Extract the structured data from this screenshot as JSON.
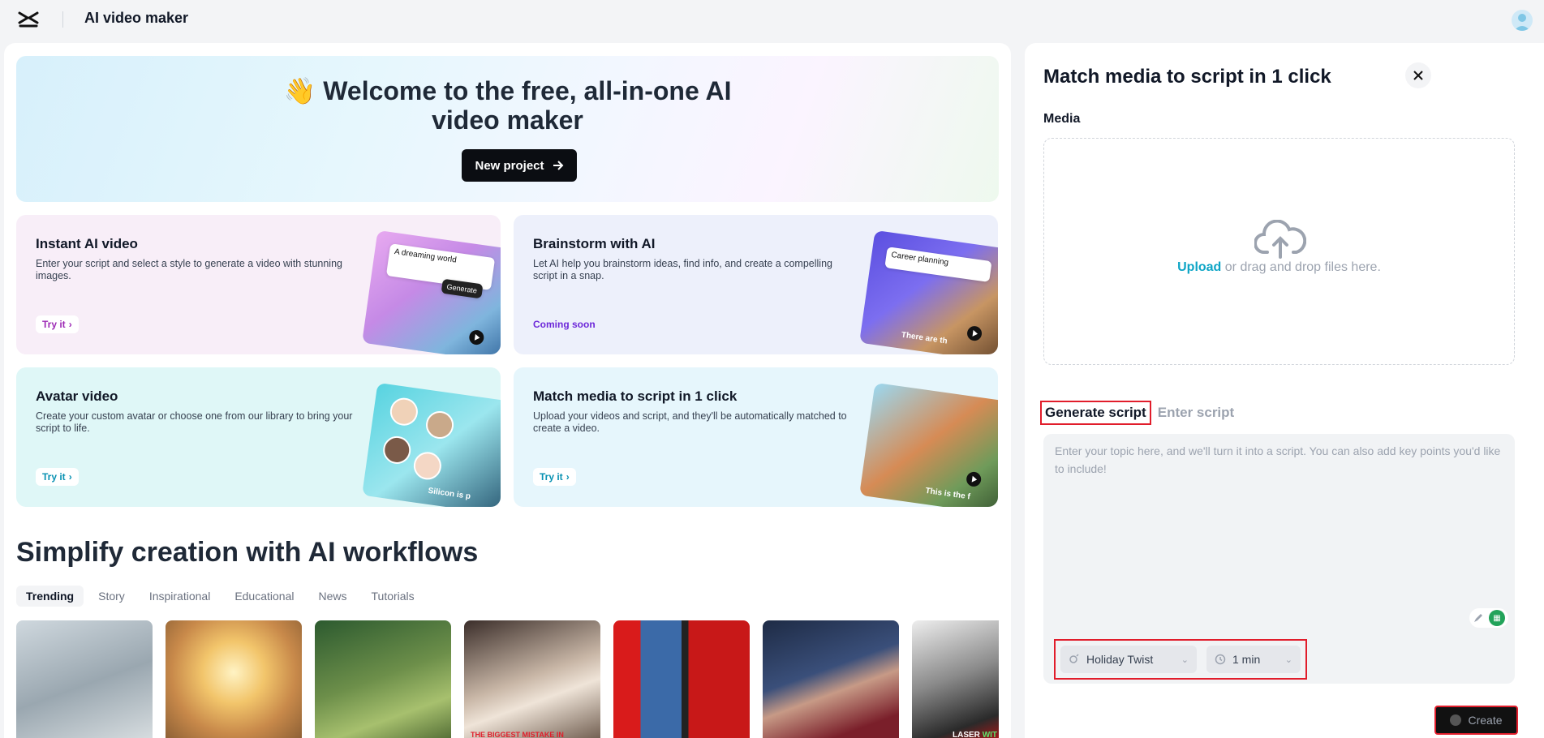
{
  "header": {
    "app_title": "AI video maker"
  },
  "hero": {
    "emoji": "👋",
    "title_line1": "Welcome to the free, all-in-one AI",
    "title_line2": "video maker",
    "new_project_label": "New project"
  },
  "cards": [
    {
      "title": "Instant AI video",
      "desc": "Enter your script and select a style to generate a video with stunning images.",
      "action": "Try it",
      "art_chip": "A dreaming world",
      "art_btn": "Generate"
    },
    {
      "title": "Brainstorm with AI",
      "desc": "Let AI help you brainstorm ideas, find info, and create a compelling script in a snap.",
      "action": "Coming soon",
      "art_chip": "Career planning",
      "art_caption": "There are th"
    },
    {
      "title": "Avatar video",
      "desc": "Create your custom avatar or choose one from our library to bring your script to life.",
      "action": "Try it",
      "art_caption": "Silicon is p"
    },
    {
      "title": "Match media to script in 1 click",
      "desc": "Upload your videos and script, and they'll be automatically matched to create a video.",
      "action": "Try it",
      "art_caption": "This is the f"
    }
  ],
  "workflows": {
    "title": "Simplify creation with AI workflows",
    "tabs": [
      "Trending",
      "Story",
      "Inspirational",
      "Educational",
      "News",
      "Tutorials"
    ],
    "active_tab": "Trending",
    "thumb_captions": {
      "t4": "THE BIGGEST MISTAKE IN",
      "t7_a": "LASER",
      "t7_b": "WIT"
    }
  },
  "panel": {
    "title": "Match media to script in 1 click",
    "media_label": "Media",
    "upload_link": "Upload",
    "upload_hint": " or drag and drop files here.",
    "tab_generate": "Generate script",
    "tab_enter": "Enter script",
    "script_placeholder": "Enter your topic here, and we'll turn it into a script. You can also add key points you'd like to include!",
    "style_value": "Holiday Twist",
    "duration_value": "1 min",
    "create_label": "Create"
  },
  "colors": {
    "accent_teal": "#0ea5c6",
    "highlight_red": "#e11d2b",
    "purple": "#6d28d9"
  },
  "icons": [
    "capcut-logo-icon",
    "user-avatar-icon",
    "arrow-right-icon",
    "chevron-right-icon",
    "play-icon",
    "close-icon",
    "cloud-upload-icon",
    "edit-icon",
    "grid-icon",
    "style-icon",
    "clock-icon",
    "chevron-down-icon",
    "spinner-icon"
  ]
}
